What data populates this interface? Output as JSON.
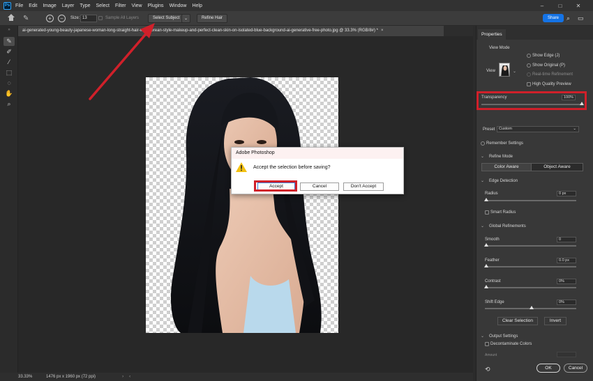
{
  "menubar": {
    "logo": "Ps",
    "items": [
      "File",
      "Edit",
      "Image",
      "Layer",
      "Type",
      "Select",
      "Filter",
      "View",
      "Plugins",
      "Window",
      "Help"
    ],
    "window_controls": [
      "–",
      "□",
      "✕"
    ]
  },
  "options": {
    "size_label": "Size:",
    "size_value": "13",
    "sample_all_layers": "Sample All Layers",
    "select_subject": "Select Subject",
    "refine_hair": "Refine Hair",
    "share": "Share"
  },
  "document": {
    "tab_title": "ai-generated-young-beauty-japanese-woman-long-straight-hair-with-korean-style-makeup-and-perfect-clean-skin-on-isolated-blue-background-ai-generative-free-photo.jpg @ 33.3% (RGB/8#) *",
    "close": "×"
  },
  "status": {
    "zoom": "33.33%",
    "dimensions": "1476 px x 1960 px (72 ppi)"
  },
  "dialog": {
    "title": "Adobe Photoshop",
    "message": "Accept the selection before saving?",
    "accept": "Accept",
    "cancel": "Cancel",
    "dont_accept": "Don't Accept"
  },
  "properties": {
    "tab": "Properties",
    "view_mode_label": "View Mode",
    "view_label": "View",
    "show_edge": "Show Edge (J)",
    "show_original": "Show Original (P)",
    "realtime_refinement": "Real-time Refinement",
    "high_quality_preview": "High Quality Preview",
    "transparency_label": "Transparency",
    "transparency_value": "100%",
    "transparency_level": 1.0,
    "preset_label": "Preset",
    "preset_value": "Custom",
    "remember_settings": "Remember Settings",
    "refine_mode_label": "Refine Mode",
    "color_aware": "Color Aware",
    "object_aware": "Object Aware",
    "edge_detection_label": "Edge Detection",
    "radius_label": "Radius",
    "radius_value": "0 px",
    "smart_radius": "Smart Radius",
    "global_refinements_label": "Global Refinements",
    "smooth_label": "Smooth",
    "smooth_value": "0",
    "feather_label": "Feather",
    "feather_value": "0.0 px",
    "contrast_label": "Contrast",
    "contrast_value": "0%",
    "shift_edge_label": "Shift Edge",
    "shift_edge_value": "0%",
    "clear_selection": "Clear Selection",
    "invert": "Invert",
    "output_settings_label": "Output Settings",
    "decontaminate_colors": "Decontaminate Colors",
    "amount_label": "Amount",
    "ok": "OK",
    "cancel": "Cancel"
  },
  "colors": {
    "accent": "#1473e6",
    "annotation_red": "#d0202a"
  }
}
